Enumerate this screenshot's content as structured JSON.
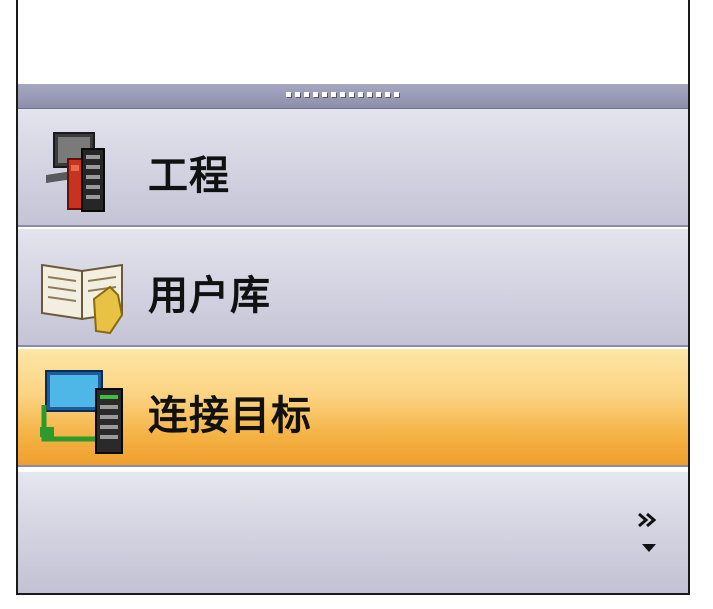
{
  "nav": {
    "items": [
      {
        "label": "工程",
        "icon": "project-icon"
      },
      {
        "label": "用户库",
        "icon": "user-library-icon"
      },
      {
        "label": "连接目标",
        "icon": "connect-target-icon",
        "selected": true
      }
    ]
  },
  "footer": {
    "overflow_icon": "chevron-overflow-icon"
  },
  "colors": {
    "selected_accent": "#f4b243",
    "item_background": "#d5d5e3",
    "splitter": "#9a9bb5"
  }
}
